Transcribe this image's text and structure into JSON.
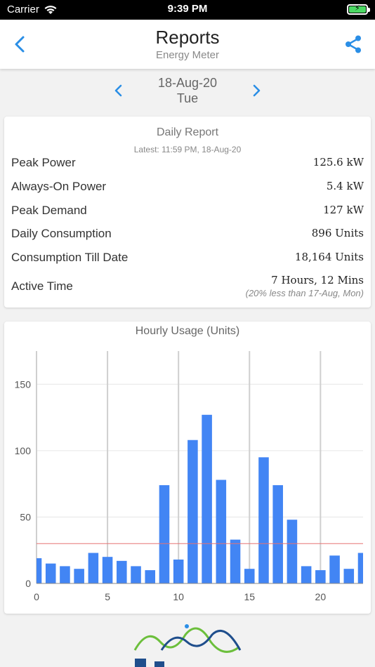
{
  "status_bar": {
    "carrier": "Carrier",
    "time": "9:39 PM"
  },
  "header": {
    "title": "Reports",
    "subtitle": "Energy Meter",
    "back_icon": "chevron-left-icon",
    "share_icon": "share-icon"
  },
  "date_nav": {
    "date": "18-Aug-20",
    "day": "Tue"
  },
  "daily_report": {
    "title": "Daily Report",
    "latest": "Latest: 11:59 PM, 18-Aug-20",
    "rows": [
      {
        "label": "Peak Power",
        "value": "125.6 kW"
      },
      {
        "label": "Always-On Power",
        "value": "5.4 kW"
      },
      {
        "label": "Peak Demand",
        "value": "127 kW"
      },
      {
        "label": "Daily Consumption",
        "value": "896 Units"
      },
      {
        "label": "Consumption Till Date",
        "value": "18,164 Units"
      },
      {
        "label": "Active Time",
        "value": "7 Hours, 12 Mins",
        "note": "(20% less than 17-Aug, Mon)"
      }
    ]
  },
  "colors": {
    "accent": "#2a8ee6",
    "bar": "#4285f4",
    "threshold": "#e57373",
    "logo_green": "#6cbf3c",
    "logo_blue": "#1f4e8c"
  },
  "chart_data": {
    "type": "bar",
    "title": "Hourly Usage (Units)",
    "x": [
      0,
      1,
      2,
      3,
      4,
      5,
      6,
      7,
      8,
      9,
      10,
      11,
      12,
      13,
      14,
      15,
      16,
      17,
      18,
      19,
      20,
      21,
      22,
      23
    ],
    "values": [
      19,
      15,
      13,
      11,
      23,
      20,
      17,
      13,
      10,
      74,
      18,
      108,
      127,
      78,
      33,
      11,
      95,
      74,
      48,
      13,
      10,
      21,
      11,
      23
    ],
    "xticks": [
      "0",
      "5",
      "10",
      "15",
      "20"
    ],
    "yticks": [
      "0",
      "50",
      "100",
      "150"
    ],
    "xlim": [
      0,
      23
    ],
    "ylim": [
      0,
      175
    ],
    "threshold": 30,
    "grid": true
  }
}
